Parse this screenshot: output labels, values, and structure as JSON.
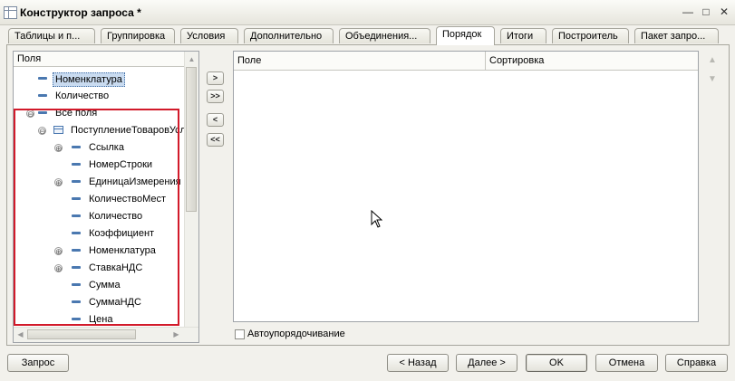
{
  "window": {
    "title": "Конструктор запроса *",
    "controls": [
      "—",
      "□",
      "✕"
    ]
  },
  "tabs": [
    {
      "label": "Таблицы и п...",
      "active": false
    },
    {
      "label": "Группировка",
      "active": false
    },
    {
      "label": "Условия",
      "active": false
    },
    {
      "label": "Дополнительно",
      "active": false
    },
    {
      "label": "Объединения...",
      "active": false
    },
    {
      "label": "Порядок",
      "active": true
    },
    {
      "label": "Итоги",
      "active": false
    },
    {
      "label": "Построитель",
      "active": false
    },
    {
      "label": "Пакет запро...",
      "active": false
    }
  ],
  "fields_tree": {
    "header": "Поля",
    "rows": [
      {
        "label": "Номенклатура",
        "icon": "attribute-icon",
        "expander": "",
        "selected": true
      },
      {
        "label": "Количество",
        "icon": "attribute-icon",
        "expander": "",
        "selected": false
      },
      {
        "label": "Все поля",
        "icon": "attribute-icon",
        "expander": "⊖",
        "selected": false
      },
      {
        "label": "ПоступлениеТоваровУсл",
        "icon": "table-icon",
        "expander": "⊖",
        "selected": false
      },
      {
        "label": "Ссылка",
        "icon": "attribute-icon",
        "expander": "⊕",
        "selected": false
      },
      {
        "label": "НомерСтроки",
        "icon": "attribute-icon",
        "expander": "",
        "selected": false
      },
      {
        "label": "ЕдиницаИзмерения",
        "icon": "attribute-icon",
        "expander": "⊕",
        "selected": false
      },
      {
        "label": "КоличествоМест",
        "icon": "attribute-icon",
        "expander": "",
        "selected": false
      },
      {
        "label": "Количество",
        "icon": "attribute-icon",
        "expander": "",
        "selected": false
      },
      {
        "label": "Коэффициент",
        "icon": "attribute-icon",
        "expander": "",
        "selected": false
      },
      {
        "label": "Номенклатура",
        "icon": "attribute-icon",
        "expander": "⊕",
        "selected": false
      },
      {
        "label": "СтавкаНДС",
        "icon": "attribute-icon",
        "expander": "⊕",
        "selected": false
      },
      {
        "label": "Сумма",
        "icon": "attribute-icon",
        "expander": "",
        "selected": false
      },
      {
        "label": "СуммаНДС",
        "icon": "attribute-icon",
        "expander": "",
        "selected": false
      },
      {
        "label": "Цена",
        "icon": "attribute-icon",
        "expander": "",
        "selected": false
      }
    ]
  },
  "move_buttons": [
    ">",
    ">>",
    "<",
    "<<"
  ],
  "order_grid": {
    "columns": [
      "Поле",
      "Сортировка"
    ]
  },
  "side_arrows": [
    "▲",
    "▼"
  ],
  "auto_order": {
    "label": "Автоупорядочивание",
    "checked": false
  },
  "footer": {
    "query": "Запрос",
    "back": "< Назад",
    "next": "Далее >",
    "ok": "OK",
    "cancel": "Отмена",
    "help": "Справка"
  },
  "colors": {
    "highlight_box": "#d21a2a",
    "selection": "#c9dbf0",
    "icon": "#4a78b0"
  }
}
